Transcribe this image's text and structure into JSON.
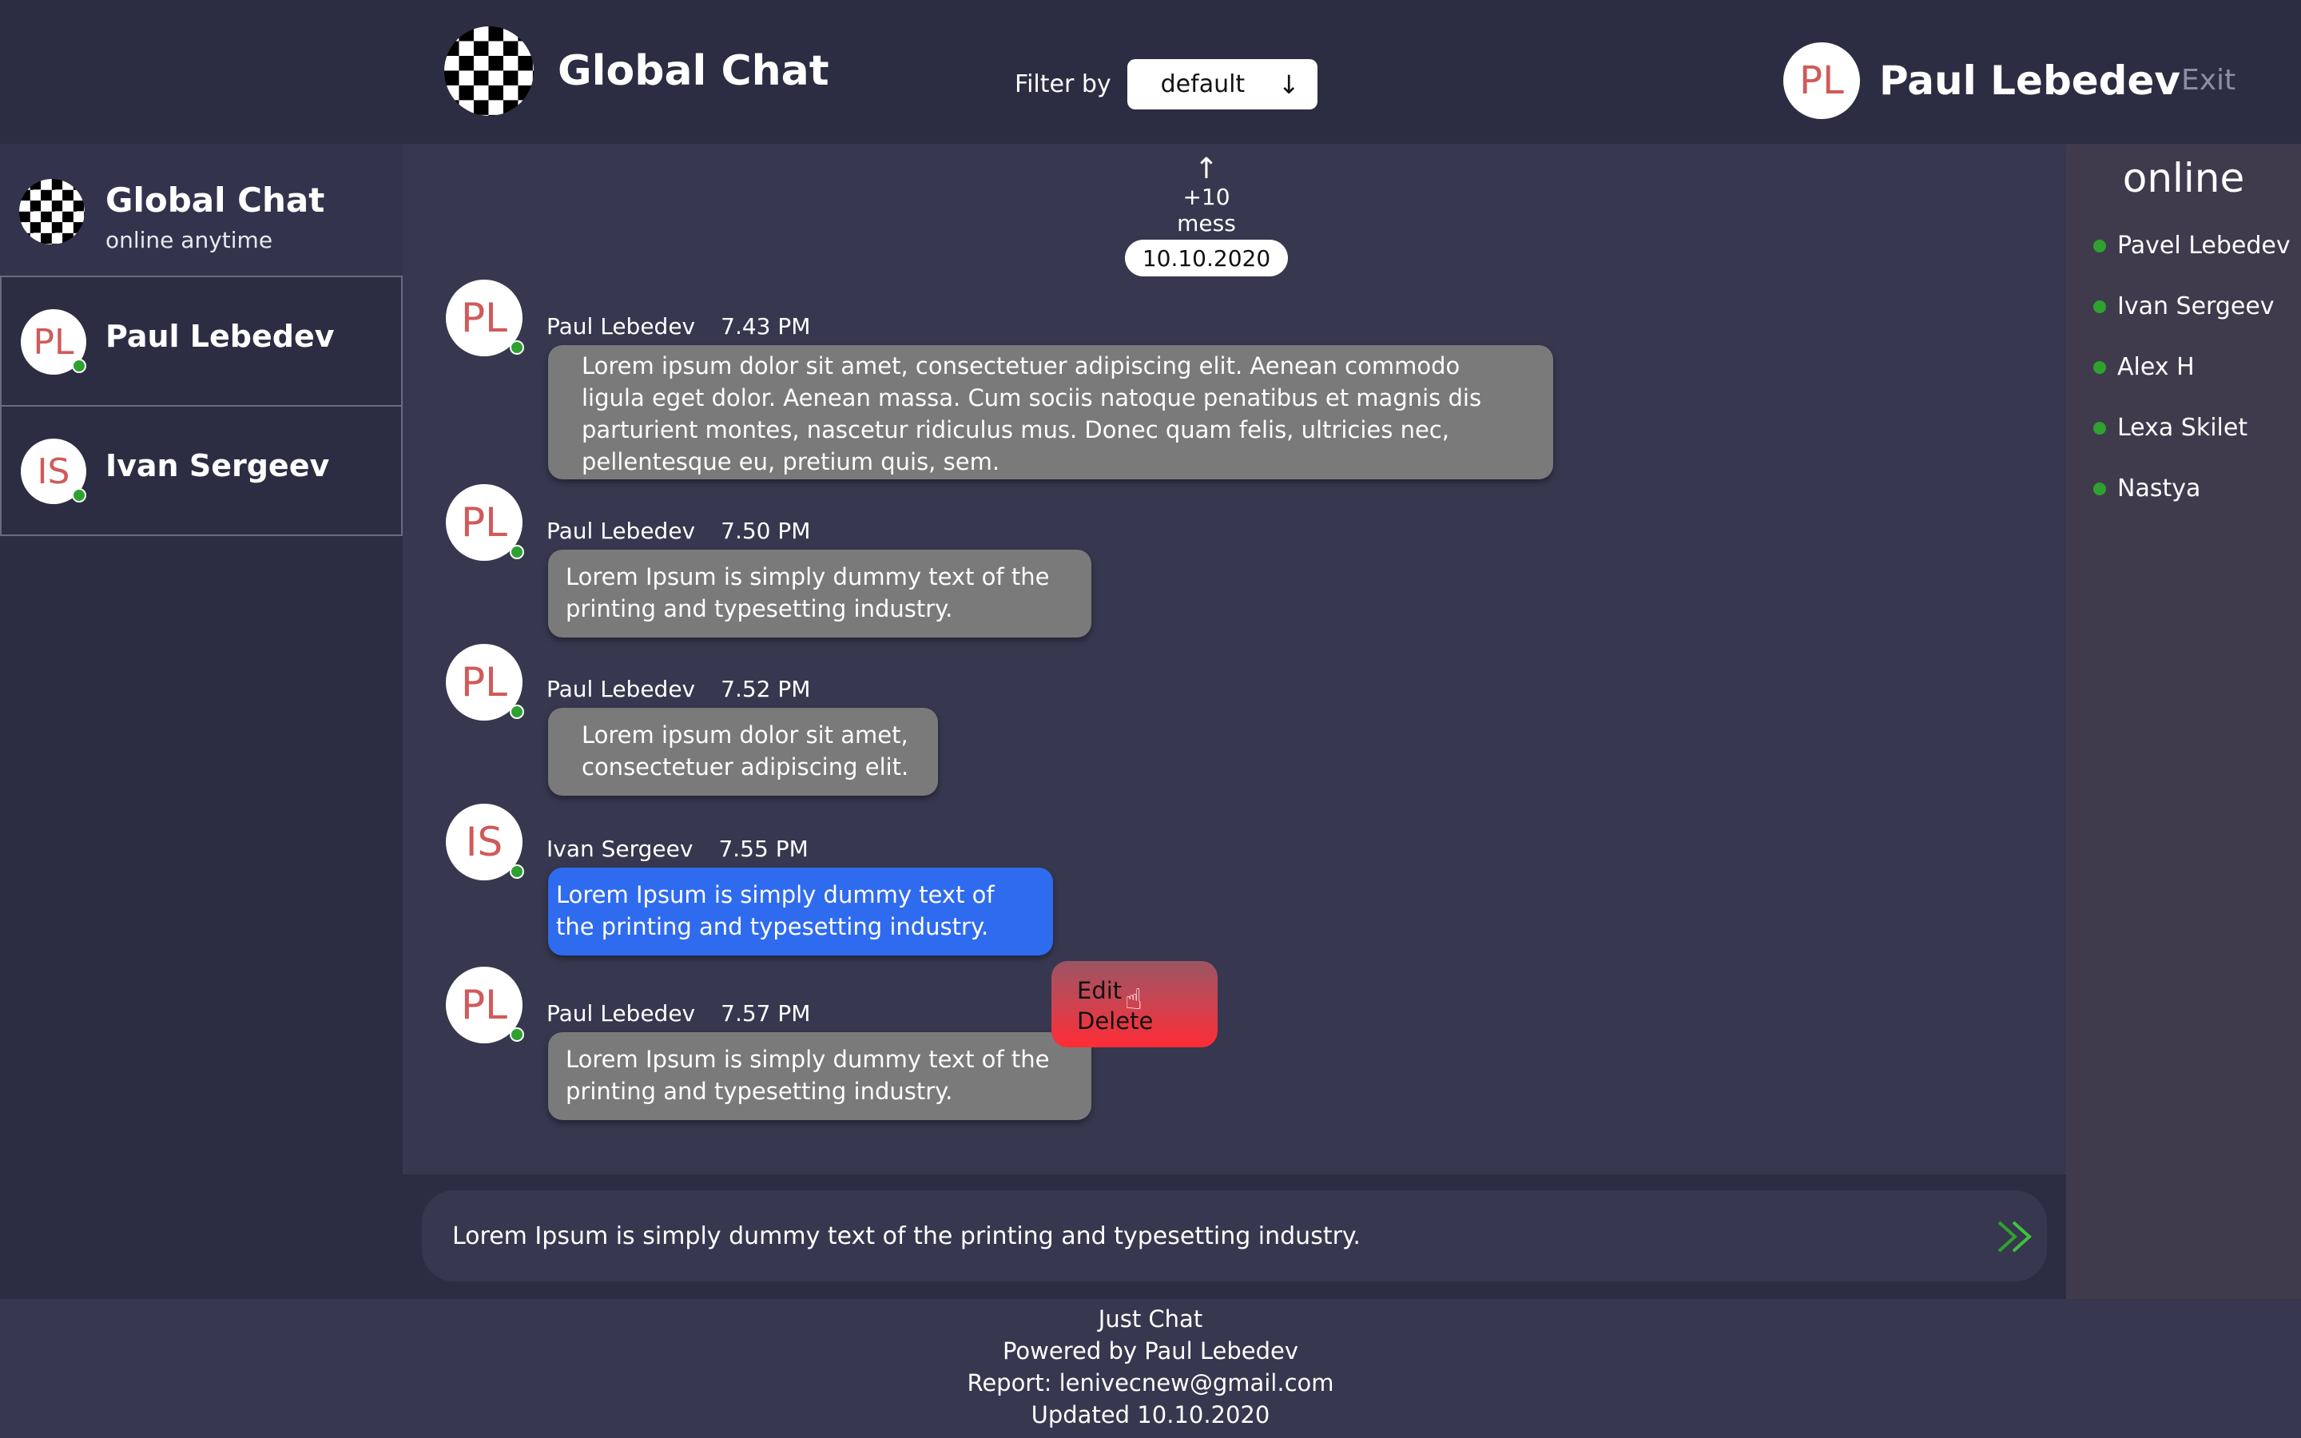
{
  "header": {
    "title": "Global Chat",
    "filter_label": "Filter by",
    "filter_value": "default",
    "user_initials": "PL",
    "user_name": "Paul Lebedev",
    "exit_label": "Exit"
  },
  "sidebar": {
    "global": {
      "title": "Global Chat",
      "subtitle": "online  anytime"
    },
    "items": [
      {
        "initials": "PL",
        "name": "Paul Lebedev"
      },
      {
        "initials": "IS",
        "name": "Ivan Sergeev"
      }
    ]
  },
  "chat": {
    "load_more": "+10 mess",
    "date": "10.10.2020",
    "messages": [
      {
        "initials": "PL",
        "author": "Paul Lebedev",
        "time": "7.43 PM",
        "text": "Lorem ipsum dolor sit amet, consectetuer adipiscing elit. Aenean commodo ligula eget dolor. Aenean massa. Cum sociis natoque penatibus et magnis dis parturient montes, nascetur ridiculus mus. Donec quam felis, ultricies nec, pellentesque eu, pretium quis, sem."
      },
      {
        "initials": "PL",
        "author": "Paul Lebedev",
        "time": "7.50 PM",
        "text": "Lorem Ipsum is simply dummy text of the printing and typesetting industry."
      },
      {
        "initials": "PL",
        "author": "Paul Lebedev",
        "time": "7.52 PM",
        "text": "Lorem ipsum dolor sit amet, consectetuer adipiscing elit."
      },
      {
        "initials": "IS",
        "author": "Ivan Sergeev",
        "time": "7.55 PM",
        "text": "Lorem Ipsum is simply dummy text of the printing and typesetting industry."
      },
      {
        "initials": "PL",
        "author": "Paul Lebedev",
        "time": "7.57 PM",
        "text": "Lorem Ipsum is simply dummy text of the printing and typesetting industry."
      }
    ],
    "context_menu": {
      "edit": "Edit",
      "delete": "Delete"
    }
  },
  "composer": {
    "value": "Lorem Ipsum is simply dummy text of the printing and typesetting industry.",
    "send_icon": "double-chevron-send-icon"
  },
  "online": {
    "title": "online",
    "users": [
      "Pavel Lebedev",
      "Ivan Sergeev",
      "Alex H",
      "Lexa Skilet",
      "Nastya"
    ]
  },
  "footer": {
    "line1": "Just Chat",
    "line2": "Powered by Paul Lebedev",
    "line3": "Report:  lenivecnew@gmail.com",
    "line4": "Updated 10.10.2020"
  },
  "colors": {
    "background": "#2c2c42",
    "chat_background": "#37374f",
    "bubble_gray": "#7a7a7a",
    "bubble_blue": "#2f6bef",
    "online_green": "#2fa12f",
    "avatar_text": "#d05a5a"
  }
}
